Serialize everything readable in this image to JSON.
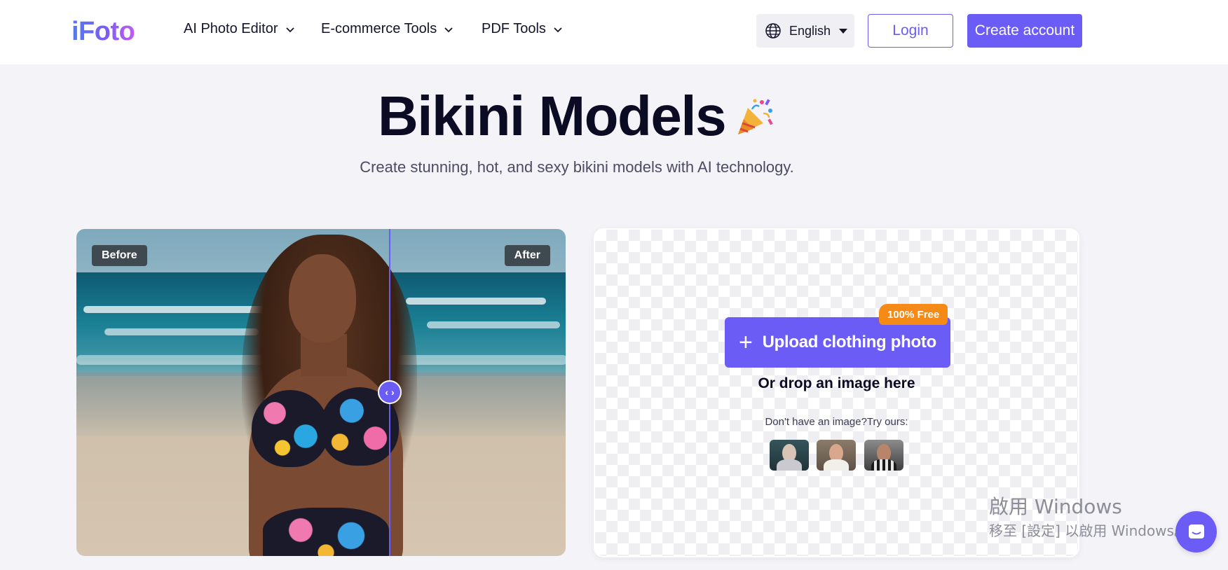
{
  "header": {
    "logo": "iFoto",
    "nav": [
      {
        "label": "AI Photo Editor"
      },
      {
        "label": "E-commerce Tools"
      },
      {
        "label": "PDF Tools"
      }
    ],
    "language": "English",
    "login_label": "Login",
    "create_label": "Create account"
  },
  "hero": {
    "title": "Bikini Models",
    "subtitle": "Create stunning, hot, and sexy bikini models with AI technology."
  },
  "compare": {
    "before_label": "Before",
    "after_label": "After",
    "handle_glyph": "‹ ›",
    "slider_position": 0.64
  },
  "upload": {
    "button_label": "Upload clothing photo",
    "badge": "100% Free",
    "drop_text": "Or drop an image here",
    "try_text": "Don't have an image?Try ours:",
    "samples": [
      "sample-woman-light",
      "sample-woman-dark-hair",
      "sample-man"
    ]
  },
  "watermark": {
    "line1": "啟用 Windows",
    "line2": "移至 [設定] 以啟用 Windows。"
  },
  "colors": {
    "accent": "#6b5cf6",
    "badge": "#f58b16",
    "background": "#f3f3f8"
  }
}
